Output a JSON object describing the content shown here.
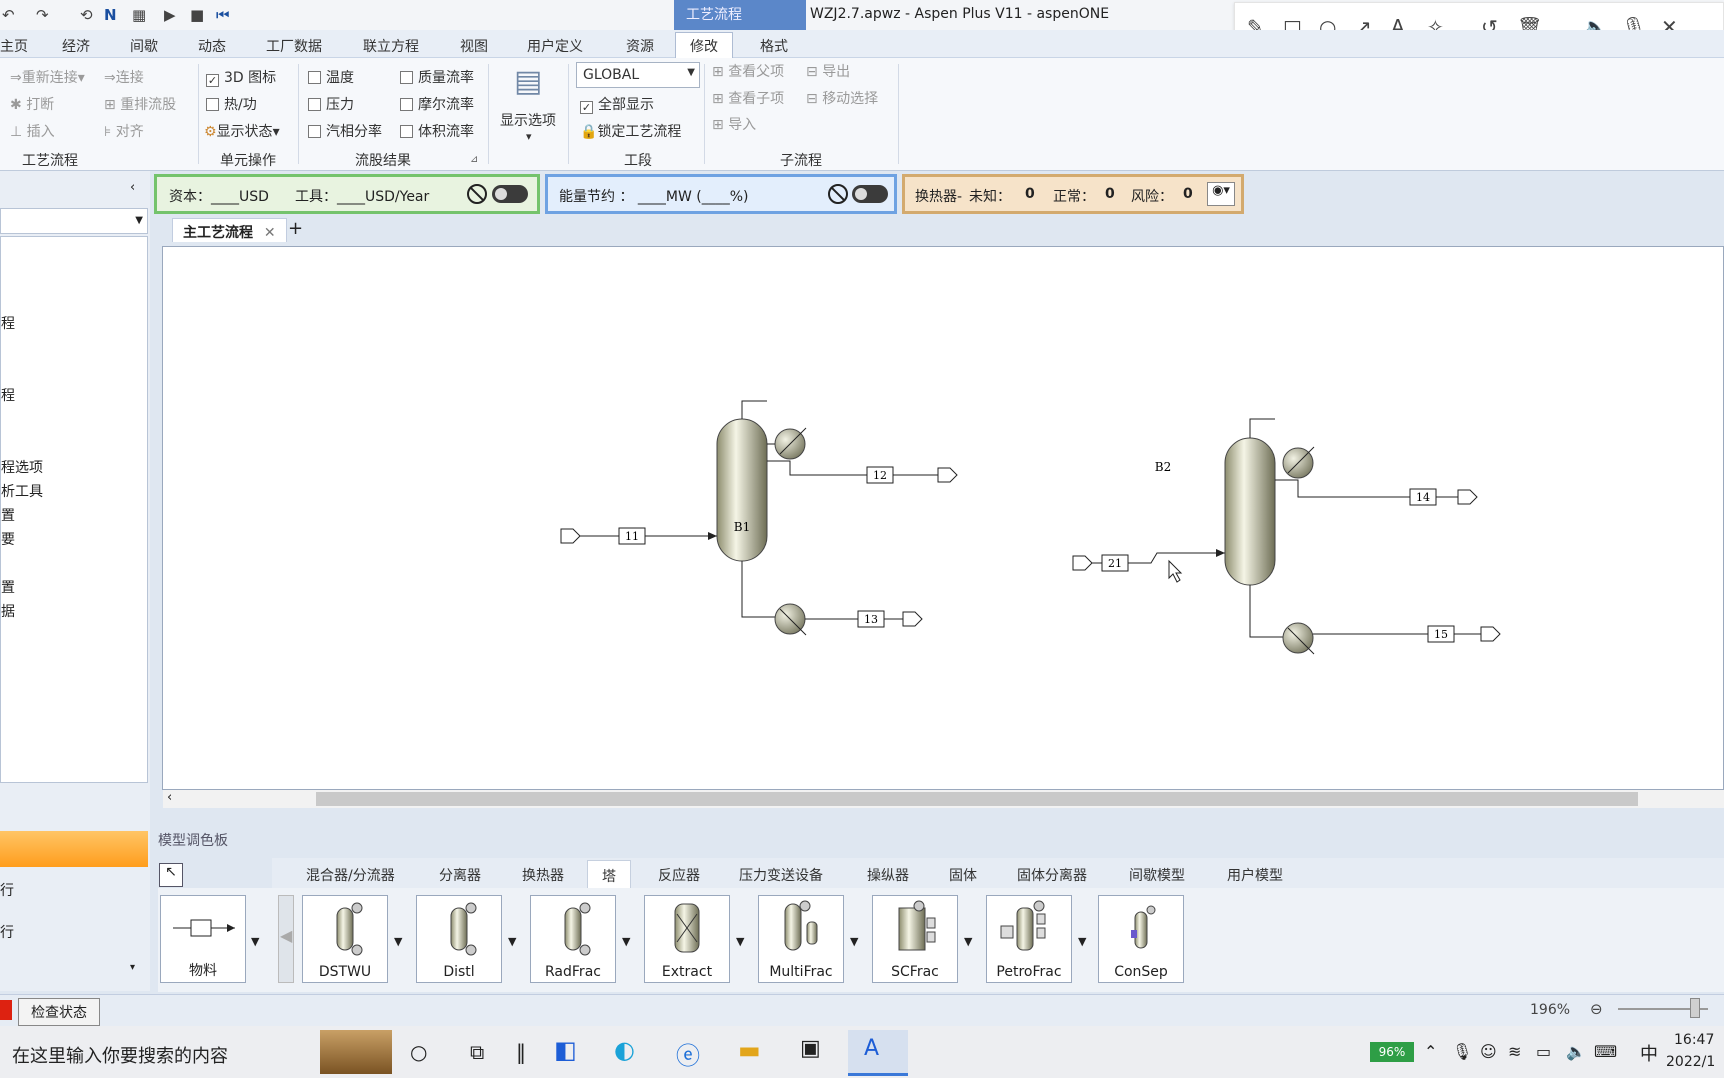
{
  "window": {
    "title": "WZJ2.7.apwz - Aspen Plus V11 - aspenONE",
    "context_tab": "工艺流程"
  },
  "menu_tabs": [
    "主页",
    "经济",
    "间歇",
    "动态",
    "工厂数据",
    "联立方程",
    "视图",
    "用户定义",
    "资源",
    "修改",
    "格式"
  ],
  "ribbon": {
    "flowsheet": {
      "reconnect": "重新连接",
      "connect": "连接",
      "break": "打断",
      "reroute": "重排流股",
      "insert": "插入",
      "align": "对齐",
      "group": "工艺流程"
    },
    "unitops": {
      "icons3d": "3D 图标",
      "heatwork": "热/功",
      "status": "显示状态",
      "group": "单元操作"
    },
    "streams": {
      "temp": "温度",
      "pressure": "压力",
      "vapor": "汽相分率",
      "massflow": "质量流率",
      "molarflow": "摩尔流率",
      "volflow": "体积流率",
      "group": "流股结果"
    },
    "display": {
      "label": "显示选项"
    },
    "section": {
      "select": "GLOBAL",
      "showall": "全部显示",
      "lock": "锁定工艺流程",
      "group": "工段"
    },
    "sub": {
      "viewparent": "查看父项",
      "viewchild": "查看子项",
      "import": "导入",
      "export": "导出",
      "move": "移动选择",
      "group": "子流程"
    }
  },
  "econ": {
    "capital": "资本：____USD",
    "utility": "工具：____USD/Year"
  },
  "energy": {
    "text": "能量节约 ： ____MW    (____%)"
  },
  "hx": {
    "label": "换热器-",
    "unknown_label": "未知：",
    "unknown": "0",
    "ok_label": "正常：",
    "ok": "0",
    "risk_label": "风险：",
    "risk": "0"
  },
  "nav_items": [
    "程",
    "程",
    "程选项",
    "析工具",
    "置",
    "要",
    "置",
    "据"
  ],
  "left_lower": [
    "行",
    "行"
  ],
  "doc_tab": "主工艺流程",
  "flowsheet": {
    "blocks": [
      {
        "name": "B1"
      },
      {
        "name": "B2"
      }
    ],
    "streams": [
      "11",
      "12",
      "13",
      "21",
      "14",
      "15"
    ]
  },
  "palette": {
    "title": "模型调色板",
    "tabs": [
      "混合器/分流器",
      "分离器",
      "换热器",
      "塔",
      "反应器",
      "压力变送设备",
      "操纵器",
      "固体",
      "固体分离器",
      "间歇模型",
      "用户模型"
    ],
    "active_tab": "塔",
    "models": [
      "物料",
      "DSTWU",
      "Distl",
      "RadFrac",
      "Extract",
      "MultiFrac",
      "SCFrac",
      "PetroFrac",
      "ConSep"
    ]
  },
  "status": {
    "check": "检查状态",
    "zoom": "196%"
  },
  "taskbar": {
    "search": "在这里输入你要搜索的内容",
    "battery": "96%",
    "ime": "中",
    "time": "16:47",
    "date": "2022/1"
  }
}
